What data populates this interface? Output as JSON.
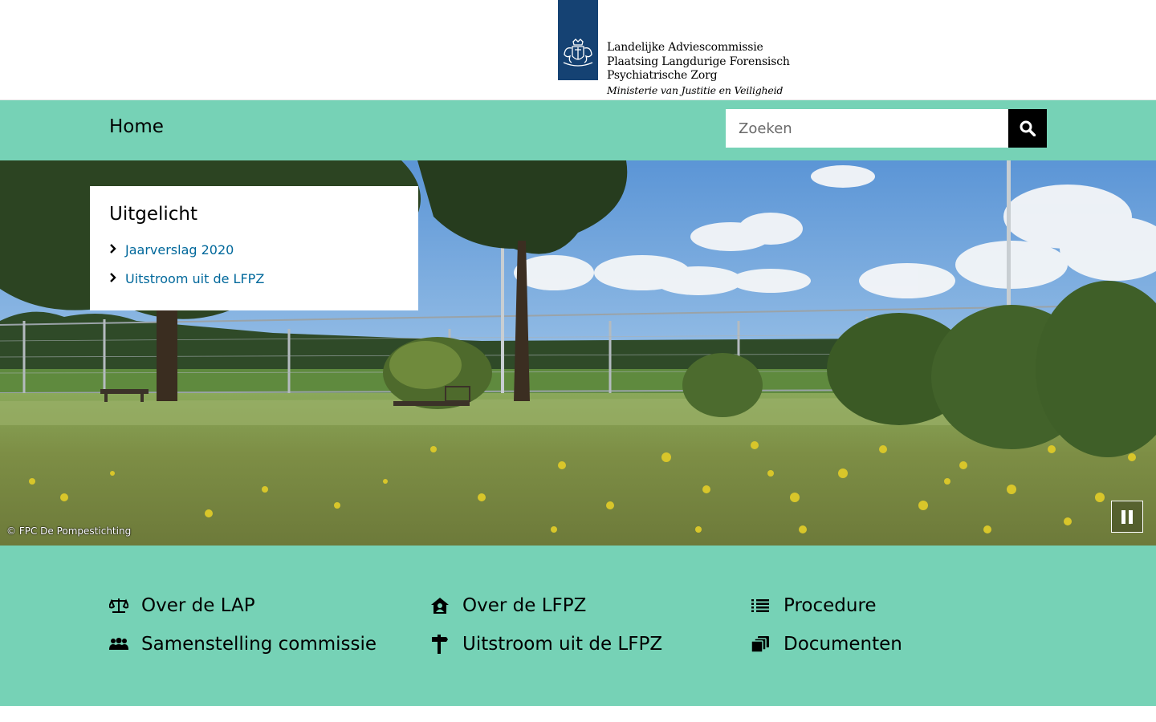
{
  "header": {
    "logo_lines": [
      "Landelijke Adviescommissie",
      "Plaatsing Langdurige Forensisch",
      "Psychiatrische Zorg"
    ],
    "ministry": "Ministerie van Justitie en Veiligheid",
    "logo_icon": "rijksoverheid-coat-of-arms",
    "brand_color": "#154273"
  },
  "nav": {
    "home_label": "Home",
    "search_placeholder": "Zoeken",
    "search_value": "",
    "search_icon": "magnifier-icon",
    "accent_color": "#76d2b6"
  },
  "featured": {
    "title": "Uitgelicht",
    "items": [
      {
        "label": "Jaarverslag 2020"
      },
      {
        "label": "Uitstroom uit de LFPZ"
      }
    ],
    "link_color": "#01689b"
  },
  "hero": {
    "credit": "© FPC De Pompestichting",
    "pause_icon": "pause-icon"
  },
  "links": [
    {
      "label": "Over de LAP",
      "icon": "scales-icon"
    },
    {
      "label": "Over de LFPZ",
      "icon": "house-person-icon"
    },
    {
      "label": "Procedure",
      "icon": "list-icon"
    },
    {
      "label": "Samenstelling commissie",
      "icon": "group-icon"
    },
    {
      "label": "Uitstroom uit de LFPZ",
      "icon": "signpost-icon"
    },
    {
      "label": "Documenten",
      "icon": "documents-icon"
    }
  ]
}
